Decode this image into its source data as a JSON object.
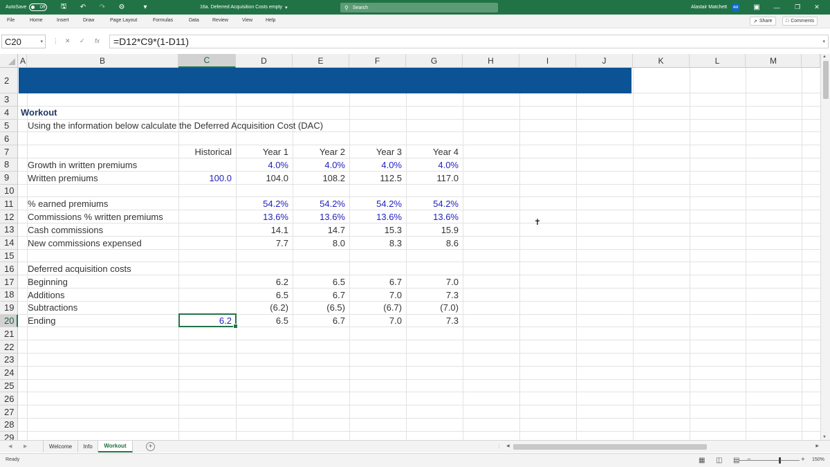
{
  "titlebar": {
    "autosave_label": "AutoSave",
    "autosave_state": "Off",
    "doc_title": "16a. Deferred Acquisition Costs empty",
    "search_placeholder": "Search",
    "user_name": "Alastair Matchett",
    "user_initials": "AM"
  },
  "menu": {
    "items": [
      "File",
      "Home",
      "Insert",
      "Draw",
      "Page Layout",
      "Formulas",
      "Data",
      "Review",
      "View",
      "Help"
    ],
    "share_label": "Share",
    "comments_label": "Comments"
  },
  "formula_bar": {
    "name_box": "C20",
    "fx_label": "fx",
    "formula": "=D12*C9*(1-D11)"
  },
  "columns": [
    "A",
    "B",
    "C",
    "D",
    "E",
    "F",
    "G",
    "H",
    "I",
    "J",
    "K",
    "L",
    "M"
  ],
  "rows": [
    "2",
    "3",
    "4",
    "5",
    "6",
    "7",
    "8",
    "9",
    "10",
    "11",
    "12",
    "13",
    "14",
    "15",
    "16",
    "17",
    "18",
    "19",
    "20",
    "21",
    "22",
    "23",
    "24",
    "25",
    "26",
    "27",
    "28",
    "29"
  ],
  "sheet": {
    "workout_title": "Workout",
    "instruction": "Using the information below calculate the Deferred Acquisition Cost (DAC)",
    "headers": [
      "Historical",
      "Year 1",
      "Year 2",
      "Year 3",
      "Year 4"
    ],
    "growth": {
      "label": "Growth in written premiums",
      "values": [
        "4.0%",
        "4.0%",
        "4.0%",
        "4.0%"
      ]
    },
    "written": {
      "label": "Written premiums",
      "historical": "100.0",
      "values": [
        "104.0",
        "108.2",
        "112.5",
        "117.0"
      ]
    },
    "earned": {
      "label": "% earned premiums",
      "values": [
        "54.2%",
        "54.2%",
        "54.2%",
        "54.2%"
      ]
    },
    "comm_pct": {
      "label": "Commissions % written premiums",
      "values": [
        "13.6%",
        "13.6%",
        "13.6%",
        "13.6%"
      ]
    },
    "cash_comm": {
      "label": "Cash commissions",
      "values": [
        "14.1",
        "14.7",
        "15.3",
        "15.9"
      ]
    },
    "new_comm": {
      "label": "New commissions expensed",
      "values": [
        "7.7",
        "8.0",
        "8.3",
        "8.6"
      ]
    },
    "dac_title": "Deferred acquisition costs",
    "beginning": {
      "label": "Beginning",
      "values": [
        "6.2",
        "6.5",
        "6.7",
        "7.0"
      ]
    },
    "additions": {
      "label": "Additions",
      "values": [
        "6.5",
        "6.7",
        "7.0",
        "7.3"
      ]
    },
    "subtractions": {
      "label": "Subtractions",
      "values": [
        "(6.2)",
        "(6.5)",
        "(6.7)",
        "(7.0)"
      ]
    },
    "ending": {
      "label": "Ending",
      "historical": "6.2",
      "values": [
        "6.5",
        "6.7",
        "7.0",
        "7.3"
      ]
    }
  },
  "tabs": [
    "Welcome",
    "Info",
    "Workout"
  ],
  "status": {
    "ready": "Ready",
    "zoom": "150%"
  },
  "colors": {
    "banner": "#0b5394",
    "input_blue": "#1f1fbf",
    "excel_green": "#217346"
  }
}
